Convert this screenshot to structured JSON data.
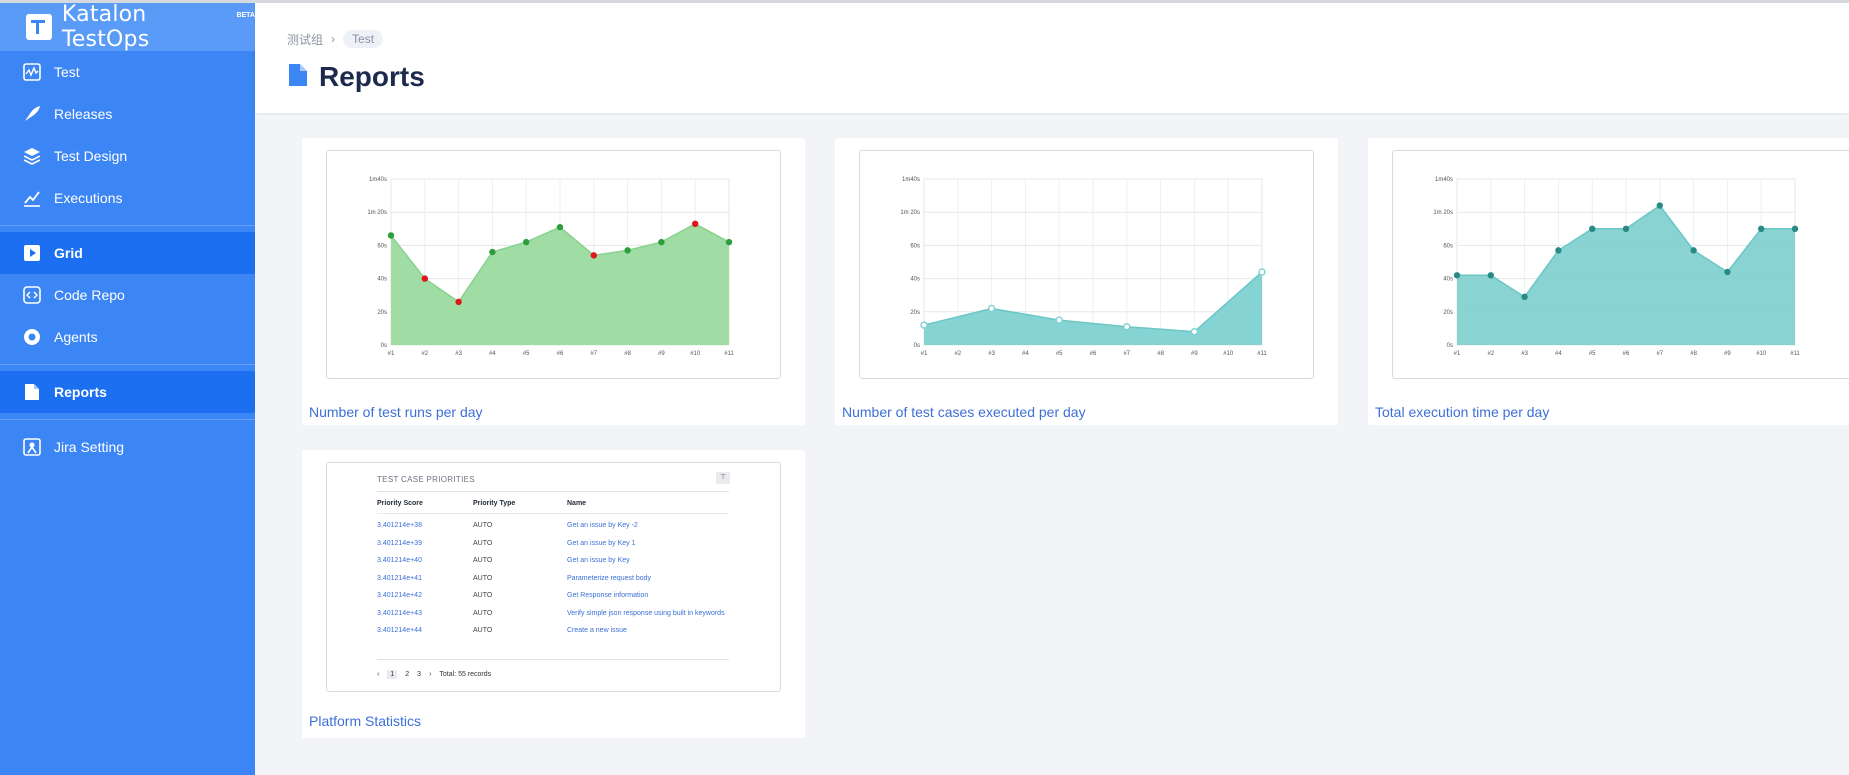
{
  "app": {
    "name": "Katalon TestOps",
    "badge": "BETA"
  },
  "sidebar": {
    "items": [
      {
        "label": "Test",
        "icon": "test-icon"
      },
      {
        "label": "Releases",
        "icon": "rocket-icon"
      },
      {
        "label": "Test Design",
        "icon": "layers-icon"
      },
      {
        "label": "Executions",
        "icon": "chart-icon"
      },
      {
        "label": "Grid",
        "icon": "play-icon"
      },
      {
        "label": "Code Repo",
        "icon": "code-icon"
      },
      {
        "label": "Agents",
        "icon": "agent-icon"
      },
      {
        "label": "Reports",
        "icon": "report-icon"
      },
      {
        "label": "Jira Setting",
        "icon": "jira-icon"
      }
    ]
  },
  "breadcrumb": {
    "parent": "测试组",
    "current": "Test"
  },
  "page": {
    "title": "Reports"
  },
  "cards": {
    "runs": {
      "label": "Number of test runs per day"
    },
    "cases": {
      "label": "Number of test cases executed per day"
    },
    "time": {
      "label": "Total execution time per day"
    },
    "platform": {
      "label": "Platform Statistics"
    }
  },
  "chart_data": [
    {
      "type": "area",
      "x": [
        "#1",
        "#2",
        "#3",
        "#4",
        "#5",
        "#6",
        "#7",
        "#8",
        "#9",
        "#10",
        "#11"
      ],
      "yticks": [
        "0s",
        "20s",
        "40s",
        "60s",
        "1m 20s",
        "1m40s"
      ],
      "ylim": [
        0,
        100
      ],
      "series": [
        {
          "values": [
            66,
            40,
            26,
            56,
            62,
            71,
            54,
            57,
            62,
            73,
            62
          ]
        }
      ],
      "point_colors": [
        "#2e9e3c",
        "#e0161c",
        "#e0161c",
        "#2e9e3c",
        "#2e9e3c",
        "#2e9e3c",
        "#e0161c",
        "#2e9e3c",
        "#2e9e3c",
        "#e0161c",
        "#2e9e3c"
      ],
      "fill": "#9bdba0",
      "line": "#89d18e"
    },
    {
      "type": "area",
      "x": [
        "#1",
        "#2",
        "#3",
        "#4",
        "#5",
        "#6",
        "#7",
        "#8",
        "#9",
        "#10",
        "#11"
      ],
      "yticks": [
        "0s",
        "20s",
        "40s",
        "60s",
        "1m 20s",
        "1m40s"
      ],
      "ylim": [
        0,
        100
      ],
      "series": [
        {
          "values": [
            12,
            22,
            15,
            11,
            8,
            44
          ],
          "x_index": [
            0,
            2,
            4,
            6,
            8,
            10
          ]
        }
      ],
      "point_style": "hollow",
      "point_colors": [
        "#7fd1d1"
      ],
      "fill": "#7fd1d1",
      "line": "#6cc6c6"
    },
    {
      "type": "area",
      "x": [
        "#1",
        "#2",
        "#3",
        "#4",
        "#5",
        "#6",
        "#7",
        "#8",
        "#9",
        "#10",
        "#11"
      ],
      "yticks": [
        "0s",
        "20s",
        "40s",
        "60s",
        "1m 20s",
        "1m40s"
      ],
      "ylim": [
        0,
        100
      ],
      "series": [
        {
          "values": [
            42,
            42,
            29,
            57,
            70,
            70,
            84,
            57,
            44,
            70,
            70
          ]
        }
      ],
      "point_colors": [
        "#2a8a86"
      ],
      "fill": "#84d1d1",
      "line": "#6cc6c6"
    }
  ],
  "table": {
    "title": "TEST CASE PRIORITIES",
    "filter_icon": "filter-icon",
    "headers": [
      "Priority Score",
      "Priority Type",
      "Name"
    ],
    "rows": [
      [
        "3.401214e+38",
        "AUTO",
        "Get an issue by Key -2"
      ],
      [
        "3.401214e+39",
        "AUTO",
        "Get an issue by Key 1"
      ],
      [
        "3.401214e+40",
        "AUTO",
        "Get an issue by Key"
      ],
      [
        "3.401214e+41",
        "AUTO",
        "Parameterize request body"
      ],
      [
        "3.401214e+42",
        "AUTO",
        "Get Response information"
      ],
      [
        "3.401214e+43",
        "AUTO",
        "Verify simple json response using built in keywords"
      ],
      [
        "3.401214e+44",
        "AUTO",
        "Create a new issue"
      ]
    ],
    "pager": {
      "prev": "‹",
      "pages": [
        "1",
        "2",
        "3"
      ],
      "next": "›",
      "total": "Total: 55 records"
    }
  }
}
